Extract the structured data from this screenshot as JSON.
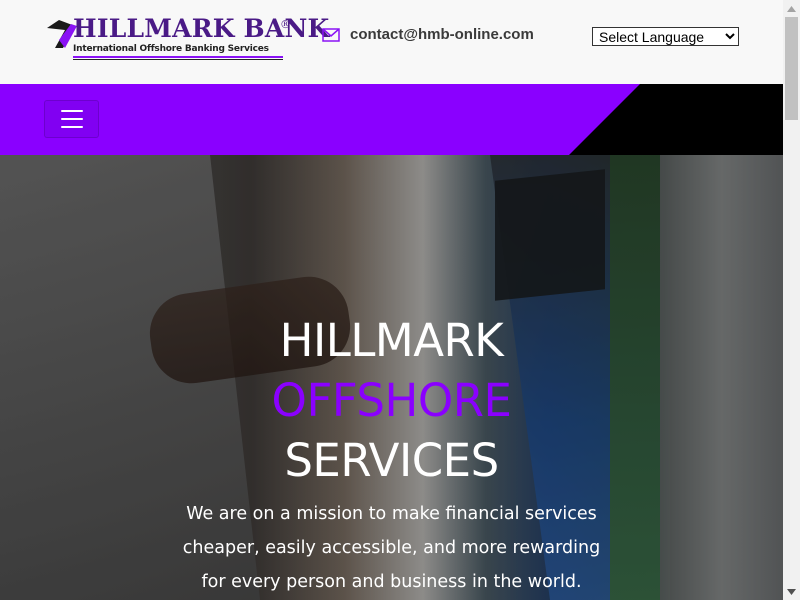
{
  "header": {
    "logo": {
      "title": "HILLMARK BANK",
      "registered": "®",
      "subtitle": "International Offshore Banking Services"
    },
    "contact": {
      "icon": "envelope-icon",
      "email": "contact@hmb-online.com"
    },
    "language_select": {
      "selected": "Select Language"
    }
  },
  "nav": {
    "menu_icon": "hamburger-menu-icon"
  },
  "hero": {
    "line1": "HILLMARK",
    "line2": "OFFSHORE",
    "line3": "SERVICES",
    "tagline": "We are on a mission to make financial services cheaper, easily accessible, and more rewarding for every person and business in the world."
  },
  "colors": {
    "accent": "#8a00ff",
    "nav_dark": "#000000",
    "topbar_bg": "#f8f8f8",
    "logo_text": "#4a1a86"
  }
}
